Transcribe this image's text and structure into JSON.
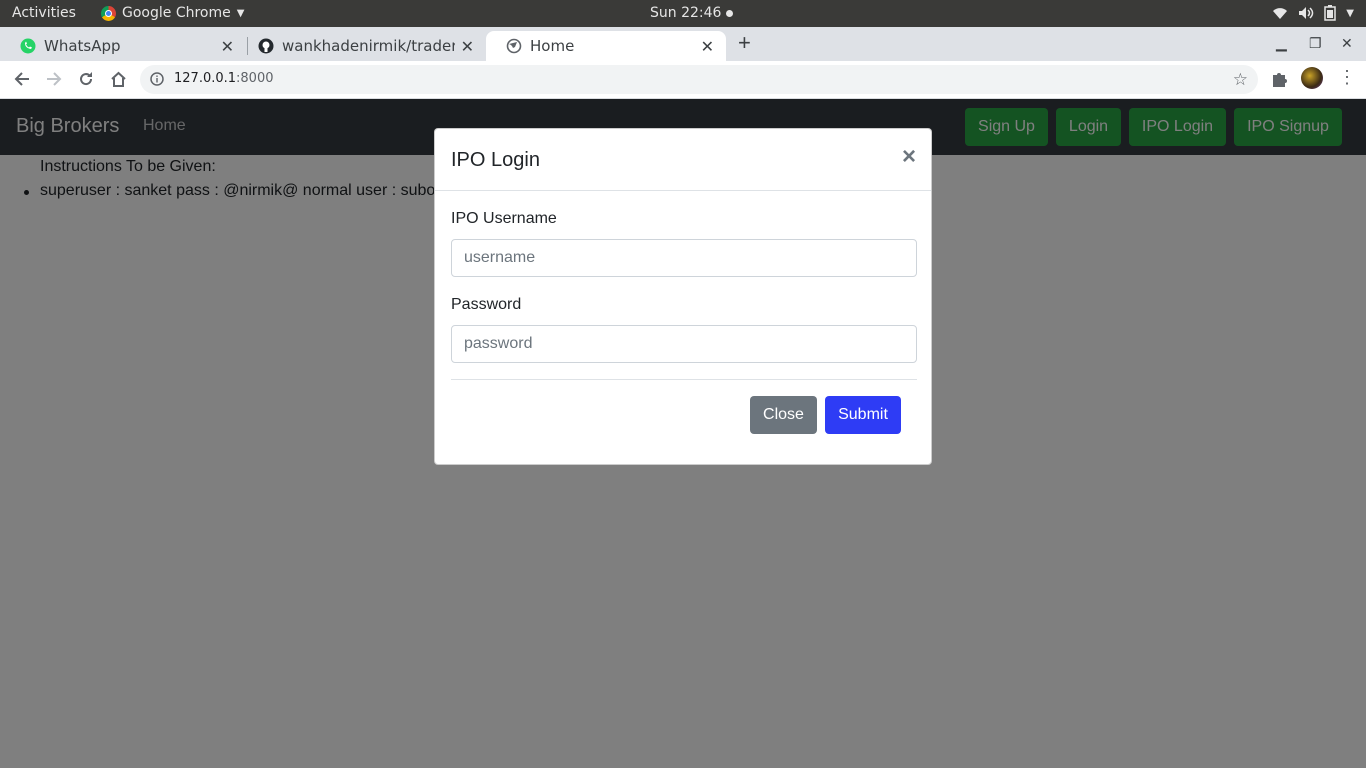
{
  "system_bar": {
    "activities": "Activities",
    "app_name": "Google Chrome",
    "clock": "Sun 22:46"
  },
  "browser": {
    "tabs": [
      {
        "title": "WhatsApp",
        "icon": "whatsapp-icon"
      },
      {
        "title": "wankhadenirmik/trader: t",
        "icon": "github-icon"
      },
      {
        "title": "Home",
        "icon": "globe-icon"
      }
    ],
    "url_host": "127.0.0.1",
    "url_port": ":8000"
  },
  "navbar": {
    "brand": "Big Brokers",
    "home": "Home",
    "buttons": [
      "Sign Up",
      "Login",
      "IPO Login",
      "IPO Signup"
    ],
    "button_color": "#28a745"
  },
  "content": {
    "instructions_title": "Instructions To be Given:",
    "instruction_item": "superuser : sanket pass : @nirmik@ normal user : subo"
  },
  "modal": {
    "title": "IPO Login",
    "close_symbol": "×",
    "username_label": "IPO Username",
    "username_placeholder": "username",
    "password_label": "Password",
    "password_placeholder": "password",
    "close_button": "Close",
    "submit_button": "Submit",
    "primary_color": "#2e3cf5",
    "secondary_color": "#6c757d"
  }
}
